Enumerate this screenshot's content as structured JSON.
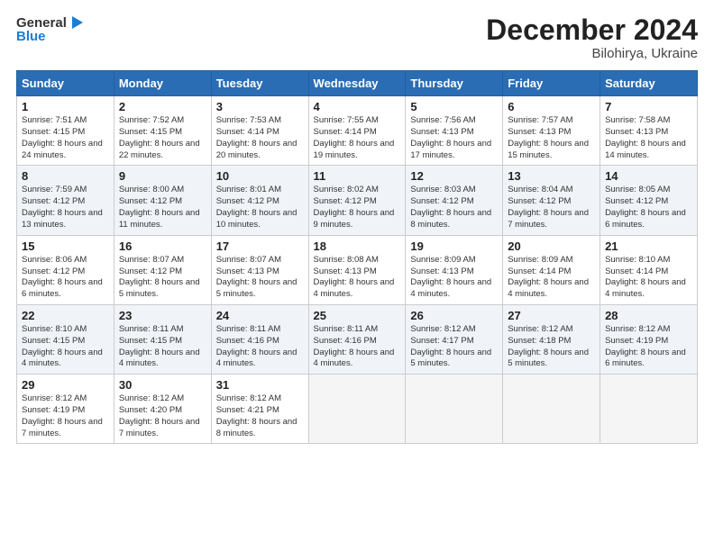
{
  "header": {
    "logo_line1": "General",
    "logo_line2": "Blue",
    "title": "December 2024",
    "subtitle": "Bilohirya, Ukraine"
  },
  "days_of_week": [
    "Sunday",
    "Monday",
    "Tuesday",
    "Wednesday",
    "Thursday",
    "Friday",
    "Saturday"
  ],
  "weeks": [
    [
      {
        "day": 1,
        "sunrise": "7:51 AM",
        "sunset": "4:15 PM",
        "daylight": "8 hours and 24 minutes."
      },
      {
        "day": 2,
        "sunrise": "7:52 AM",
        "sunset": "4:15 PM",
        "daylight": "8 hours and 22 minutes."
      },
      {
        "day": 3,
        "sunrise": "7:53 AM",
        "sunset": "4:14 PM",
        "daylight": "8 hours and 20 minutes."
      },
      {
        "day": 4,
        "sunrise": "7:55 AM",
        "sunset": "4:14 PM",
        "daylight": "8 hours and 19 minutes."
      },
      {
        "day": 5,
        "sunrise": "7:56 AM",
        "sunset": "4:13 PM",
        "daylight": "8 hours and 17 minutes."
      },
      {
        "day": 6,
        "sunrise": "7:57 AM",
        "sunset": "4:13 PM",
        "daylight": "8 hours and 15 minutes."
      },
      {
        "day": 7,
        "sunrise": "7:58 AM",
        "sunset": "4:13 PM",
        "daylight": "8 hours and 14 minutes."
      }
    ],
    [
      {
        "day": 8,
        "sunrise": "7:59 AM",
        "sunset": "4:12 PM",
        "daylight": "8 hours and 13 minutes."
      },
      {
        "day": 9,
        "sunrise": "8:00 AM",
        "sunset": "4:12 PM",
        "daylight": "8 hours and 11 minutes."
      },
      {
        "day": 10,
        "sunrise": "8:01 AM",
        "sunset": "4:12 PM",
        "daylight": "8 hours and 10 minutes."
      },
      {
        "day": 11,
        "sunrise": "8:02 AM",
        "sunset": "4:12 PM",
        "daylight": "8 hours and 9 minutes."
      },
      {
        "day": 12,
        "sunrise": "8:03 AM",
        "sunset": "4:12 PM",
        "daylight": "8 hours and 8 minutes."
      },
      {
        "day": 13,
        "sunrise": "8:04 AM",
        "sunset": "4:12 PM",
        "daylight": "8 hours and 7 minutes."
      },
      {
        "day": 14,
        "sunrise": "8:05 AM",
        "sunset": "4:12 PM",
        "daylight": "8 hours and 6 minutes."
      }
    ],
    [
      {
        "day": 15,
        "sunrise": "8:06 AM",
        "sunset": "4:12 PM",
        "daylight": "8 hours and 6 minutes."
      },
      {
        "day": 16,
        "sunrise": "8:07 AM",
        "sunset": "4:12 PM",
        "daylight": "8 hours and 5 minutes."
      },
      {
        "day": 17,
        "sunrise": "8:07 AM",
        "sunset": "4:13 PM",
        "daylight": "8 hours and 5 minutes."
      },
      {
        "day": 18,
        "sunrise": "8:08 AM",
        "sunset": "4:13 PM",
        "daylight": "8 hours and 4 minutes."
      },
      {
        "day": 19,
        "sunrise": "8:09 AM",
        "sunset": "4:13 PM",
        "daylight": "8 hours and 4 minutes."
      },
      {
        "day": 20,
        "sunrise": "8:09 AM",
        "sunset": "4:14 PM",
        "daylight": "8 hours and 4 minutes."
      },
      {
        "day": 21,
        "sunrise": "8:10 AM",
        "sunset": "4:14 PM",
        "daylight": "8 hours and 4 minutes."
      }
    ],
    [
      {
        "day": 22,
        "sunrise": "8:10 AM",
        "sunset": "4:15 PM",
        "daylight": "8 hours and 4 minutes."
      },
      {
        "day": 23,
        "sunrise": "8:11 AM",
        "sunset": "4:15 PM",
        "daylight": "8 hours and 4 minutes."
      },
      {
        "day": 24,
        "sunrise": "8:11 AM",
        "sunset": "4:16 PM",
        "daylight": "8 hours and 4 minutes."
      },
      {
        "day": 25,
        "sunrise": "8:11 AM",
        "sunset": "4:16 PM",
        "daylight": "8 hours and 4 minutes."
      },
      {
        "day": 26,
        "sunrise": "8:12 AM",
        "sunset": "4:17 PM",
        "daylight": "8 hours and 5 minutes."
      },
      {
        "day": 27,
        "sunrise": "8:12 AM",
        "sunset": "4:18 PM",
        "daylight": "8 hours and 5 minutes."
      },
      {
        "day": 28,
        "sunrise": "8:12 AM",
        "sunset": "4:19 PM",
        "daylight": "8 hours and 6 minutes."
      }
    ],
    [
      {
        "day": 29,
        "sunrise": "8:12 AM",
        "sunset": "4:19 PM",
        "daylight": "8 hours and 7 minutes."
      },
      {
        "day": 30,
        "sunrise": "8:12 AM",
        "sunset": "4:20 PM",
        "daylight": "8 hours and 7 minutes."
      },
      {
        "day": 31,
        "sunrise": "8:12 AM",
        "sunset": "4:21 PM",
        "daylight": "8 hours and 8 minutes."
      },
      null,
      null,
      null,
      null
    ]
  ]
}
